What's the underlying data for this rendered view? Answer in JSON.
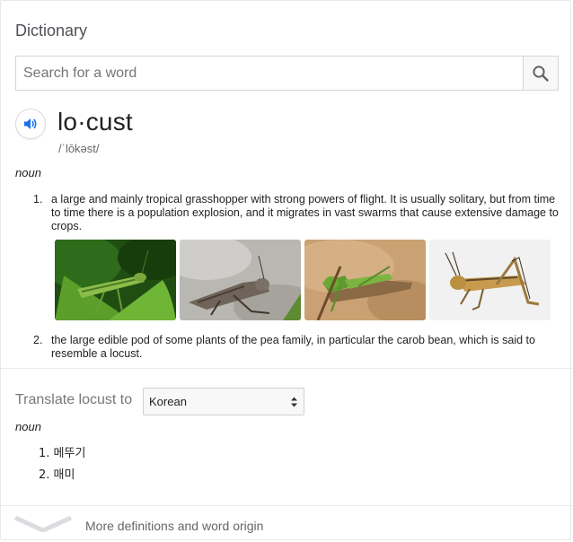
{
  "header": {
    "title": "Dictionary"
  },
  "search": {
    "placeholder": "Search for a word",
    "value": ""
  },
  "entry": {
    "word": "lo·cust",
    "pronunciation": "/ˈlōkəst/",
    "part_of_speech": "noun",
    "definitions": [
      {
        "number": "1.",
        "text": "a large and mainly tropical grasshopper with strong powers of flight. It is usually solitary, but from time to time there is a population explosion, and it migrates in vast swarms that cause extensive damage to crops."
      },
      {
        "number": "2.",
        "text": "the large edible pod of some plants of the pea family, in particular the carob bean, which is said to resemble a locust."
      }
    ],
    "images": [
      "locust-on-leaf",
      "locust-on-gravel",
      "green-locust-on-sand",
      "locust-on-white"
    ]
  },
  "translate": {
    "label": "Translate locust to",
    "language": "Korean",
    "part_of_speech": "noun",
    "items": [
      {
        "number": "1.",
        "text": "메뚜기"
      },
      {
        "number": "2.",
        "text": "매미"
      }
    ]
  },
  "footer": {
    "more_label": "More definitions and word origin"
  },
  "colors": {
    "accent": "#1a73e8",
    "muted": "#777777"
  }
}
